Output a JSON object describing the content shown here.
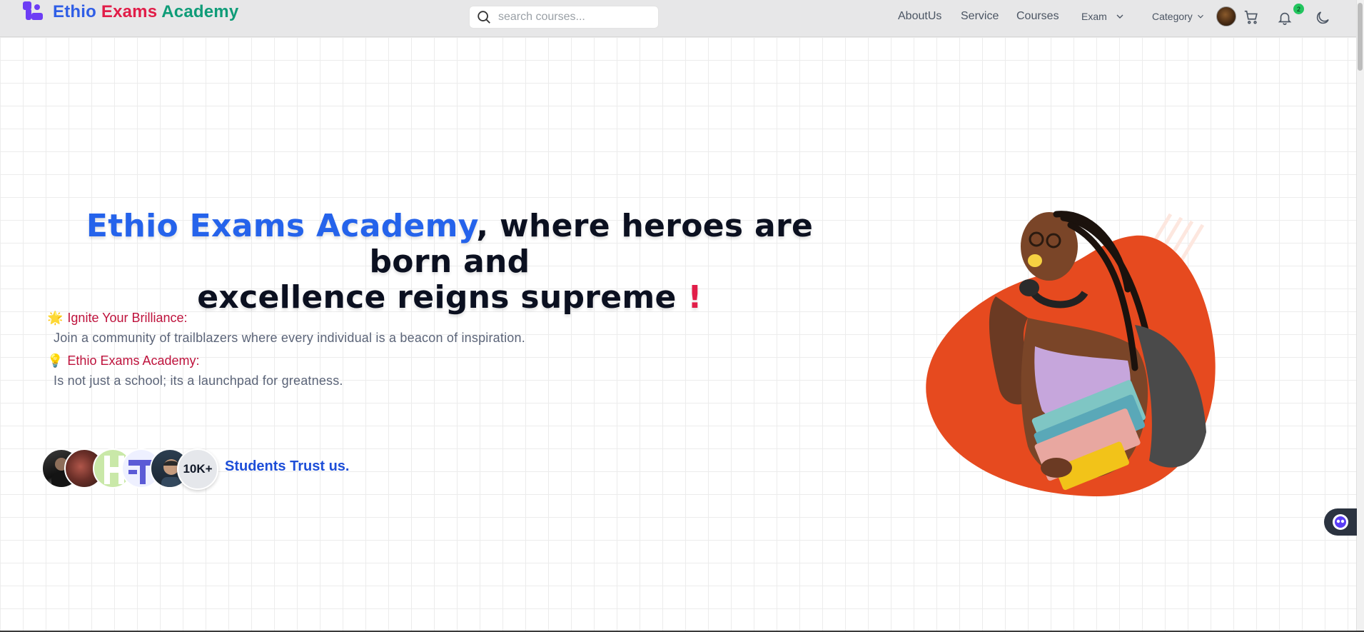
{
  "brand": {
    "word1": "Ethio",
    "word2": "Exams",
    "word3": "Academy",
    "colors": {
      "word1": "#2f5ee6",
      "word2": "#e11d48",
      "word3": "#0f9c78",
      "logo_mark": "#6d3df5"
    }
  },
  "search": {
    "placeholder": "search courses...",
    "value": "",
    "icon": "search-icon"
  },
  "nav": {
    "links": [
      "AboutUs",
      "Service",
      "Courses"
    ],
    "exam_label": "Exam",
    "category_label": "Category",
    "notifications_count": "2",
    "icons": [
      "avatar",
      "cart-icon",
      "bell-icon",
      "moon-icon"
    ]
  },
  "hero": {
    "title_brand": "Ethio Exams Academy",
    "title_line1_rest": ", where heroes are born and",
    "title_line2": "excellence reigns supreme",
    "title_exclaim": "!",
    "features": [
      {
        "emoji": "🌟",
        "heading": "Ignite Your Brilliance:",
        "text": "Join a community of trailblazers where every individual is a beacon of inspiration."
      },
      {
        "emoji": "💡",
        "heading": "Ethio Exams Academy:",
        "text": "Is not just a school; its a launchpad for greatness."
      }
    ],
    "students_count": "10K+",
    "trust_text": "Students Trust us.",
    "accent_colors": {
      "brand": "#2563eb",
      "exclaim": "#e11d48",
      "feature_heading": "#be123c",
      "trust": "#1d4ed8",
      "blob": "#e64a1f"
    }
  },
  "chat_widget": {
    "icon": "chatbot-icon"
  }
}
